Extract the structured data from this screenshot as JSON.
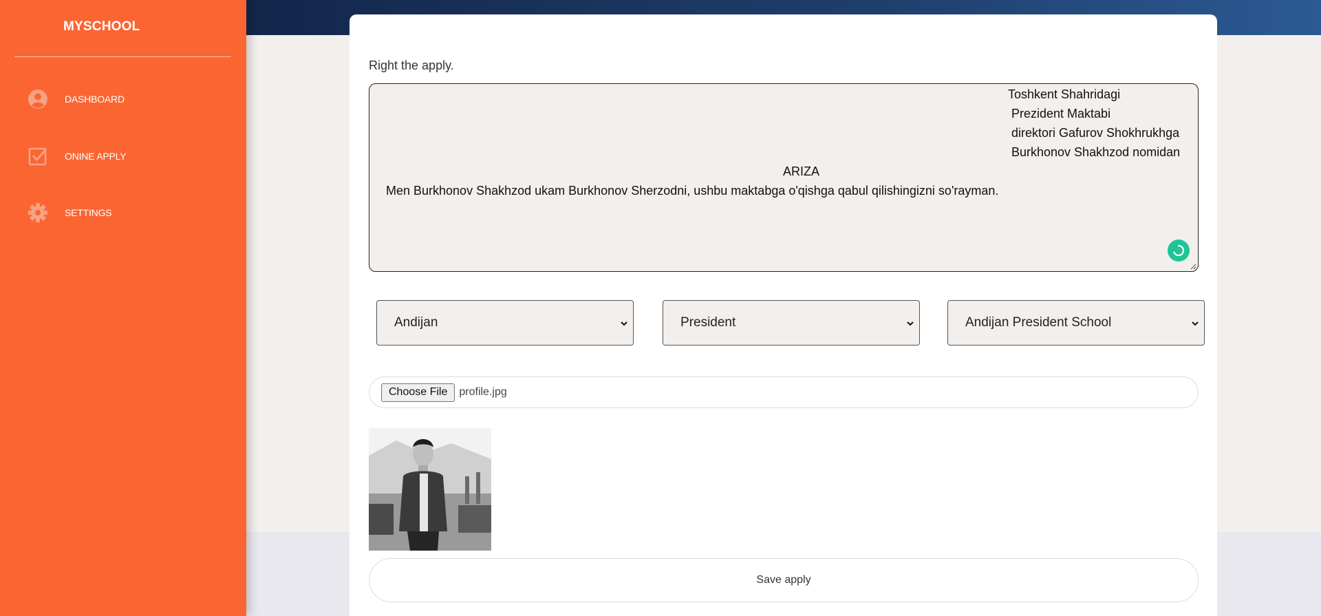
{
  "sidebar": {
    "brand": "MYSCHOOL",
    "items": [
      {
        "label": "DASHBOARD",
        "icon": "user-circle-icon"
      },
      {
        "label": "ONINE APPLY",
        "icon": "checkbox-icon"
      },
      {
        "label": "SETTINGS",
        "icon": "gear-icon"
      }
    ]
  },
  "form": {
    "label": "Right the apply.",
    "letter_lines": [
      "Toshkent Shahridagi",
      "Prezident Maktabi",
      "direktori Gafurov Shokhrukhga",
      "Burkhonov Shakhzod nomidan",
      "ARIZA",
      "Men Burkhonov Shakhzod ukam Burkhonov Sherzodni, ushbu maktabga o'qishga qabul qilishingizni so'rayman."
    ],
    "region_select": "Andijan",
    "type_select": "President",
    "school_select": "Andijan President School",
    "file_button": "Choose File",
    "file_name": "profile.jpg",
    "save_label": "Save apply"
  },
  "colors": {
    "sidebar": "#fb6532",
    "accent_green": "#1fc497",
    "header_navy": "#13264a"
  }
}
